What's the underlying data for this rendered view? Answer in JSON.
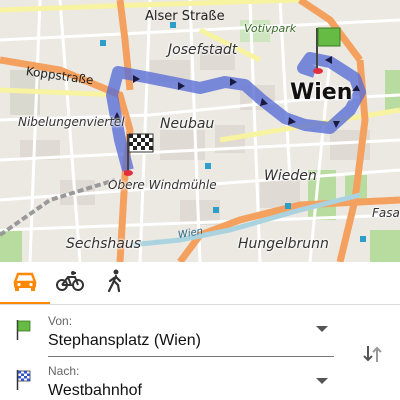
{
  "map": {
    "labels": {
      "city": "Wien",
      "josefstadt": "Josefstadt",
      "neubau": "Neubau",
      "wieden": "Wieden",
      "sechshaus": "Sechshaus",
      "hungelbrunn": "Hungelbrunn",
      "nibelungenviertel": "Nibelungenviertel",
      "obere_windmuehle": "Obere Windmühle",
      "votivpark": "Votivpark",
      "alser_strasse": "Alser Straße",
      "koppstrasse": "Koppstraße",
      "wien_river": "Wien",
      "fasan": "Fasan"
    },
    "colors": {
      "route": "#5b6fd6",
      "start_flag": "#66bb44",
      "major_road": "#f4a160",
      "yellow_road": "#f7f3a0"
    }
  },
  "transport_modes": [
    {
      "name": "car",
      "icon": "car-icon",
      "active": true
    },
    {
      "name": "bicycle",
      "icon": "bicycle-icon",
      "active": false
    },
    {
      "name": "walk",
      "icon": "pedestrian-icon",
      "active": false
    }
  ],
  "from": {
    "label": "Von:",
    "value": "Stephansplatz (Wien)",
    "icon": "green-flag-icon"
  },
  "to": {
    "label": "Nach:",
    "value": "Westbahnhof",
    "icon": "checkered-flag-icon"
  },
  "swap_icon": "swap-arrows-icon",
  "accent_color": "#ff8800"
}
